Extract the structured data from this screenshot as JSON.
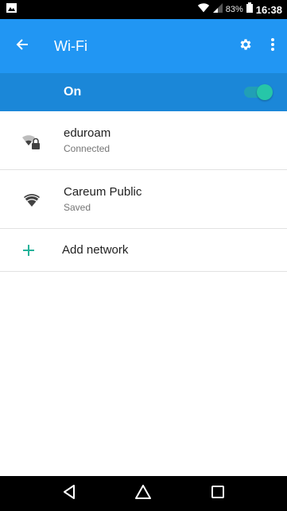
{
  "status_bar": {
    "battery_percent": "83%",
    "time": "16:38",
    "icons": [
      "image-notification-icon",
      "wifi-signal-icon",
      "cell-signal-icon",
      "battery-icon"
    ]
  },
  "toolbar": {
    "title": "Wi-Fi",
    "icons": [
      "back-arrow-icon",
      "gear-icon",
      "more-vert-icon"
    ]
  },
  "master_switch": {
    "label": "On",
    "state": "on",
    "accent_color": "#26c6a8"
  },
  "networks": [
    {
      "name": "eduroam",
      "status": "Connected",
      "icon": "wifi-locked-icon"
    },
    {
      "name": "Careum Public",
      "status": "Saved",
      "icon": "wifi-icon"
    }
  ],
  "add_network": {
    "label": "Add network",
    "icon": "plus-icon"
  },
  "colors": {
    "toolbar": "#2196f3",
    "master_row": "#1b87d8",
    "accent": "#26b39a"
  },
  "nav_bar": {
    "icons": [
      "back-triangle-icon",
      "home-circle-icon",
      "recents-square-icon"
    ]
  }
}
